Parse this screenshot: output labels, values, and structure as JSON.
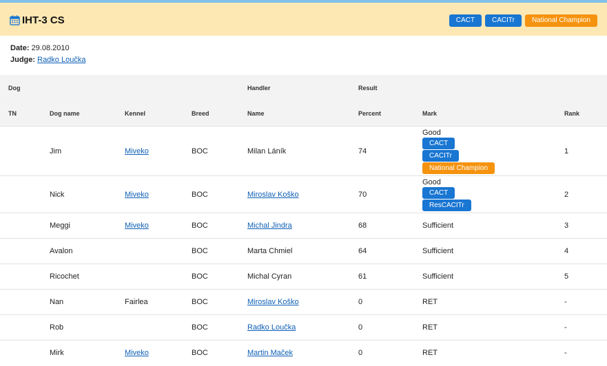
{
  "header": {
    "title": "IHT-3 CS",
    "icon": "calendar-icon",
    "badges": [
      {
        "label": "CACT",
        "color": "#1976d2"
      },
      {
        "label": "CACITr",
        "color": "#1976d2"
      },
      {
        "label": "National Champion",
        "color": "#f5930f"
      }
    ]
  },
  "meta": {
    "date_label": "Date:",
    "date_value": "29.08.2010",
    "judge_label": "Judge:",
    "judge_value": "Radko Loučka"
  },
  "table": {
    "groups": {
      "dog": "Dog",
      "handler": "Handler",
      "result": "Result"
    },
    "columns": {
      "tn": "TN",
      "dog_name": "Dog name",
      "kennel": "Kennel",
      "breed": "Breed",
      "name": "Name",
      "percent": "Percent",
      "mark": "Mark",
      "rank": "Rank"
    },
    "rows": [
      {
        "tn": "",
        "dog_name": "Jim",
        "kennel": "Miveko",
        "breed": "BOC",
        "handler": "Milan Láník",
        "handler_link": false,
        "percent": "74",
        "mark": "Good",
        "awards": [
          "CACT",
          "CACITr",
          "National Champion"
        ],
        "rank": "1"
      },
      {
        "tn": "",
        "dog_name": "Nick",
        "kennel": "Miveko",
        "breed": "BOC",
        "handler": "Miroslav Koško",
        "handler_link": true,
        "percent": "70",
        "mark": "Good",
        "awards": [
          "CACT",
          "ResCACITr"
        ],
        "rank": "2"
      },
      {
        "tn": "",
        "dog_name": "Meggi",
        "kennel": "Miveko",
        "breed": "BOC",
        "handler": "Michal Jindra",
        "handler_link": true,
        "percent": "68",
        "mark": "Sufficient",
        "awards": [],
        "rank": "3"
      },
      {
        "tn": "",
        "dog_name": "Avalon",
        "kennel": "",
        "breed": "BOC",
        "handler": "Marta Chmiel",
        "handler_link": false,
        "percent": "64",
        "mark": "Sufficient",
        "awards": [],
        "rank": "4"
      },
      {
        "tn": "",
        "dog_name": "Ricochet",
        "kennel": "",
        "breed": "BOC",
        "handler": "Michal Cyran",
        "handler_link": false,
        "percent": "61",
        "mark": "Sufficient",
        "awards": [],
        "rank": "5"
      },
      {
        "tn": "",
        "dog_name": "Nan",
        "kennel": "Fairlea",
        "kennel_plain": true,
        "breed": "BOC",
        "handler": "Miroslav Koško",
        "handler_link": true,
        "percent": "0",
        "mark": "RET",
        "awards": [],
        "rank": "-"
      },
      {
        "tn": "",
        "dog_name": "Rob",
        "kennel": "",
        "breed": "BOC",
        "handler": "Radko Loučka",
        "handler_link": true,
        "percent": "0",
        "mark": "RET",
        "awards": [],
        "rank": "-"
      },
      {
        "tn": "",
        "dog_name": "Mirk",
        "kennel": "Miveko",
        "breed": "BOC",
        "handler": "Martin Maček",
        "handler_link": true,
        "percent": "0",
        "mark": "RET",
        "awards": [],
        "rank": "-"
      }
    ]
  }
}
